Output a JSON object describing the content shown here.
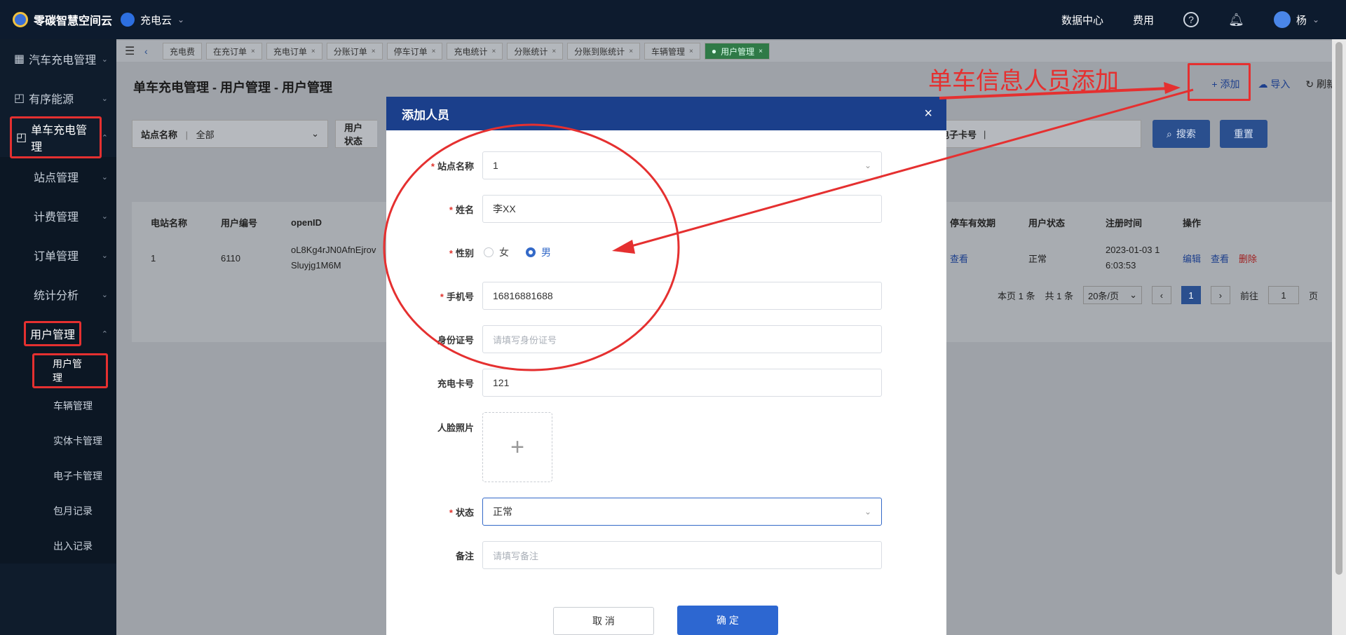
{
  "brand": {
    "title": "零碳智慧空间云",
    "app": "充电云"
  },
  "top_right": {
    "data_center": "数据中心",
    "fees": "费用",
    "help_icon": "?",
    "user": "杨"
  },
  "sidebar": {
    "items": [
      {
        "label": "汽车充电管理",
        "icon": "grid-icon"
      },
      {
        "label": "有序能源",
        "icon": "chart-icon"
      },
      {
        "label": "单车充电管理",
        "icon": "chart-icon"
      },
      {
        "label": "站点管理"
      },
      {
        "label": "计费管理"
      },
      {
        "label": "订单管理"
      },
      {
        "label": "统计分析"
      },
      {
        "label": "用户管理"
      }
    ],
    "sub_items": [
      "用户管理",
      "车辆管理",
      "实体卡管理",
      "电子卡管理",
      "包月记录",
      "出入记录"
    ]
  },
  "tabs": [
    "充电费",
    "在充订单",
    "充电订单",
    "分账订单",
    "停车订单",
    "充电统计",
    "分账统计",
    "分账到账统计",
    "车辆管理",
    "用户管理"
  ],
  "page": {
    "title": "单车充电管理 - 用户管理 - 用户管理",
    "add": "+ 添加",
    "import": "导入",
    "refresh": "刷新"
  },
  "filters": {
    "station_label": "站点名称",
    "station_value": "全部",
    "user_status_label": "用户状态",
    "ecard_label": "电子卡号",
    "search": "搜索",
    "reset": "重置"
  },
  "table": {
    "headers": [
      "电站名称",
      "用户编号",
      "openID",
      "停车有效期",
      "用户状态",
      "注册时间",
      "操作"
    ],
    "row": {
      "station": "1",
      "user_no": "6110",
      "openid_1": "oL8Kg4rJN0AfnEjrov",
      "openid_2": "Sluyjg1M6M",
      "parking": "查看",
      "status": "正常",
      "reg_1": "2023-01-03 1",
      "reg_2": "6:03:53",
      "edit": "编辑",
      "view": "查看",
      "delete": "删除"
    }
  },
  "pager": {
    "page_info": "本页 1 条",
    "total": "共 1 条",
    "page_size": "20条/页",
    "current": "1",
    "goto": "前往",
    "goto_value": "1",
    "page_suffix": "页"
  },
  "modal": {
    "title": "添加人员",
    "close": "×",
    "fields": {
      "station_label": "站点名称",
      "station_value": "1",
      "name_label": "姓名",
      "name_value": "李XX",
      "gender_label": "性别",
      "gender_female": "女",
      "gender_male": "男",
      "phone_label": "手机号",
      "phone_value": "16816881688",
      "id_label": "身份证号",
      "id_placeholder": "请填写身份证号",
      "card_label": "充电卡号",
      "card_value": "121",
      "face_label": "人脸照片",
      "status_label": "状态",
      "status_value": "正常",
      "remark_label": "备注",
      "remark_placeholder": "请填写备注"
    },
    "cancel": "取 消",
    "confirm": "确 定"
  },
  "annotation": {
    "text": "单车信息人员添加",
    "color": "#e53030"
  }
}
